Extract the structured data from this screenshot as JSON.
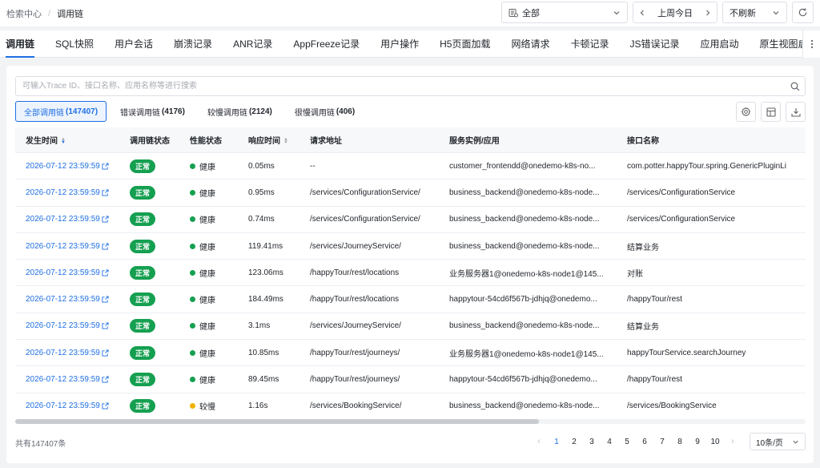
{
  "breadcrumb": {
    "root": "检索中心",
    "separator": "/",
    "current": "调用链"
  },
  "header": {
    "app_select": "全部",
    "time_range": "上周今日",
    "refresh": "不刷新"
  },
  "tabs": [
    "调用链",
    "SQL快照",
    "用户会话",
    "崩溃记录",
    "ANR记录",
    "AppFreeze记录",
    "用户操作",
    "H5页面加载",
    "网络请求",
    "卡顿记录",
    "JS错误记录",
    "应用启动",
    "原生视图启动"
  ],
  "search": {
    "placeholder": "可输入Trace ID、接口名称、应用名称等进行搜索",
    "value": ""
  },
  "filters": [
    {
      "label": "全部调用链",
      "count": "(147407)"
    },
    {
      "label": "错误调用链",
      "count": "(4176)"
    },
    {
      "label": "较慢调用链",
      "count": "(2124)"
    },
    {
      "label": "很慢调用链",
      "count": "(406)"
    }
  ],
  "table": {
    "columns": [
      "发生时间",
      "调用链状态",
      "性能状态",
      "响应时间",
      "请求地址",
      "服务实例/应用",
      "接口名称"
    ],
    "rows": [
      {
        "time": "2026-07-12 23:59:59",
        "status": "正常",
        "perf": "健康",
        "perf_color": "#15a051",
        "resp": "0.05ms",
        "url": "--",
        "service": "customer_frontendd@onedemo-k8s-no...",
        "api": "com.potter.happyTour.spring.GenericPluginLi"
      },
      {
        "time": "2026-07-12 23:59:59",
        "status": "正常",
        "perf": "健康",
        "perf_color": "#15a051",
        "resp": "0.95ms",
        "url": "/services/ConfigurationService/",
        "service": "business_backend@onedemo-k8s-node...",
        "api": "/services/ConfigurationService"
      },
      {
        "time": "2026-07-12 23:59:59",
        "status": "正常",
        "perf": "健康",
        "perf_color": "#15a051",
        "resp": "0.74ms",
        "url": "/services/ConfigurationService/",
        "service": "business_backend@onedemo-k8s-node...",
        "api": "/services/ConfigurationService"
      },
      {
        "time": "2026-07-12 23:59:59",
        "status": "正常",
        "perf": "健康",
        "perf_color": "#15a051",
        "resp": "119.41ms",
        "url": "/services/JourneyService/",
        "service": "business_backend@onedemo-k8s-node...",
        "api": "结算业务"
      },
      {
        "time": "2026-07-12 23:59:59",
        "status": "正常",
        "perf": "健康",
        "perf_color": "#15a051",
        "resp": "123.06ms",
        "url": "/happyTour/rest/locations",
        "service": "业务服务器1@onedemo-k8s-node1@145...",
        "api": "对账"
      },
      {
        "time": "2026-07-12 23:59:59",
        "status": "正常",
        "perf": "健康",
        "perf_color": "#15a051",
        "resp": "184.49ms",
        "url": "/happyTour/rest/locations",
        "service": "happytour-54cd6f567b-jdhjq@onedemo...",
        "api": "/happyTour/rest"
      },
      {
        "time": "2026-07-12 23:59:59",
        "status": "正常",
        "perf": "健康",
        "perf_color": "#15a051",
        "resp": "3.1ms",
        "url": "/services/JourneyService/",
        "service": "business_backend@onedemo-k8s-node...",
        "api": "结算业务"
      },
      {
        "time": "2026-07-12 23:59:59",
        "status": "正常",
        "perf": "健康",
        "perf_color": "#15a051",
        "resp": "10.85ms",
        "url": "/happyTour/rest/journeys/",
        "service": "业务服务器1@onedemo-k8s-node1@145...",
        "api": "happyTourService.searchJourney"
      },
      {
        "time": "2026-07-12 23:59:59",
        "status": "正常",
        "perf": "健康",
        "perf_color": "#15a051",
        "resp": "89.45ms",
        "url": "/happyTour/rest/journeys/",
        "service": "happytour-54cd6f567b-jdhjq@onedemo...",
        "api": "/happyTour/rest"
      },
      {
        "time": "2026-07-12 23:59:59",
        "status": "正常",
        "perf": "较慢",
        "perf_color": "#f0b400",
        "resp": "1.16s",
        "url": "/services/BookingService/",
        "service": "business_backend@onedemo-k8s-node...",
        "api": "/services/BookingService"
      }
    ]
  },
  "footer": {
    "total": "共有147407条",
    "pages": [
      "1",
      "2",
      "3",
      "4",
      "5",
      "6",
      "7",
      "8",
      "9",
      "10"
    ],
    "current_page": "1",
    "page_size": "10条/页"
  },
  "colors": {
    "accent": "#1e6fe3",
    "ok": "#15a051",
    "slow": "#f0b400"
  }
}
